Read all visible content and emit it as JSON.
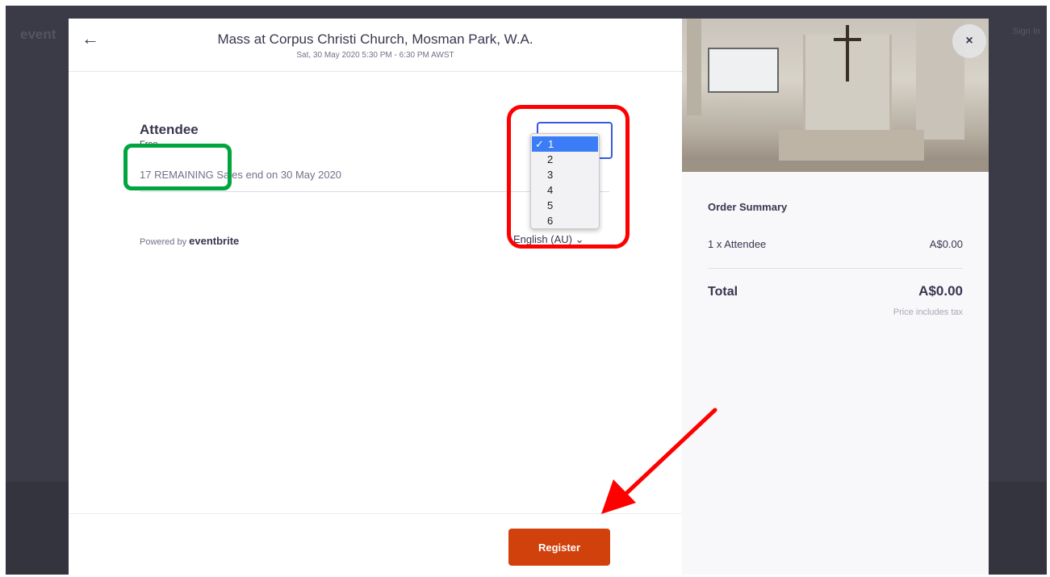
{
  "background": {
    "logo": "event",
    "signin": "Sign In"
  },
  "header": {
    "title": "Mass at Corpus Christi Church, Mosman Park, W.A.",
    "subtitle": "Sat, 30 May 2020 5:30 PM - 6:30 PM AWST"
  },
  "ticket": {
    "name": "Attendee",
    "price": "Free",
    "remaining": "17 REMAINING",
    "sales_end": "Sales end on 30 May 2020"
  },
  "quantity": {
    "options": [
      "1",
      "2",
      "3",
      "4",
      "5",
      "6"
    ],
    "selected": "1",
    "check": "✓"
  },
  "powered_by": {
    "prefix": "Powered by ",
    "brand": "eventbrite"
  },
  "language": {
    "label": "English (AU)",
    "chevron": "⌄"
  },
  "footer": {
    "register_label": "Register"
  },
  "order_summary": {
    "title": "Order Summary",
    "line_label": "1 x Attendee",
    "line_price": "A$0.00",
    "total_label": "Total",
    "total_value": "A$0.00",
    "tax_note": "Price includes tax"
  },
  "icons": {
    "back": "←",
    "close": "×"
  },
  "colors": {
    "brand_orange": "#d1410c",
    "focus_blue": "#3659e3",
    "annotation_red": "#ff0000",
    "annotation_green": "#00a540"
  }
}
